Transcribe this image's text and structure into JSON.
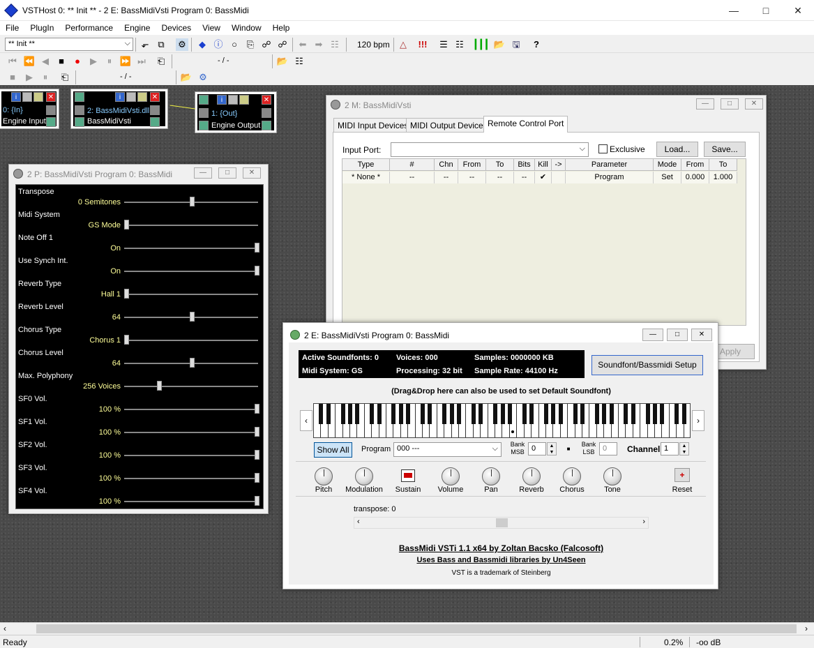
{
  "app": {
    "title": "VSTHost 0: ** Init ** - 2 E: BassMidiVsti Program 0: BassMidi"
  },
  "menu": [
    "File",
    "PlugIn",
    "Performance",
    "Engine",
    "Devices",
    "View",
    "Window",
    "Help"
  ],
  "toolbar": {
    "performance": "** Init **",
    "bpm": "120 bpm",
    "position1": "- / -",
    "position2": "- / -"
  },
  "engine": {
    "input": {
      "line1": "0: {In}",
      "line2": "Engine Input"
    },
    "plugin": {
      "line1": "2: BassMidiVsti.dll",
      "line2": "BassMidiVsti"
    },
    "output": {
      "line1": "1: {Out}",
      "line2": "Engine Output"
    }
  },
  "param_window": {
    "title": "2 P: BassMidiVsti Program 0: BassMidi",
    "params": [
      {
        "label": "Transpose",
        "value": "0 Semitones",
        "level": 0.5
      },
      {
        "label": "Midi System",
        "value": "GS Mode",
        "level": 0.0
      },
      {
        "label": "Note Off 1",
        "value": "On",
        "level": 1.0
      },
      {
        "label": "Use Synch Int.",
        "value": "On",
        "level": 1.0
      },
      {
        "label": "Reverb Type",
        "value": "Hall 1",
        "level": 0.0
      },
      {
        "label": "Reverb Level",
        "value": "64",
        "level": 0.5
      },
      {
        "label": "Chorus Type",
        "value": "Chorus 1",
        "level": 0.0
      },
      {
        "label": "Chorus Level",
        "value": "64",
        "level": 0.5
      },
      {
        "label": "Max. Polyphony",
        "value": "256 Voices",
        "level": 0.25
      },
      {
        "label": "SF0 Vol.",
        "value": "100 %",
        "level": 1.0
      },
      {
        "label": "SF1 Vol.",
        "value": "100 %",
        "level": 1.0
      },
      {
        "label": "SF2 Vol.",
        "value": "100 %",
        "level": 1.0
      },
      {
        "label": "SF3 Vol.",
        "value": "100 %",
        "level": 1.0
      },
      {
        "label": "SF4 Vol.",
        "value": "100 %",
        "level": 1.0
      }
    ]
  },
  "midi_window": {
    "title": "2 M: BassMidiVsti",
    "tabs": [
      "MIDI Input Devices",
      "MIDI Output Devices",
      "Remote Control Port"
    ],
    "input_port_label": "Input Port:",
    "exclusive_label": "Exclusive",
    "load_label": "Load...",
    "save_label": "Save...",
    "apply_label": "Apply",
    "columns": [
      "Type",
      "#",
      "Chn",
      "From",
      "To",
      "Bits",
      "Kill",
      "->",
      "Parameter",
      "Mode",
      "From",
      "To"
    ],
    "row": [
      "* None *",
      "--",
      "--",
      "--",
      "--",
      "--",
      "✔",
      "",
      "Program",
      "Set",
      "0.000",
      "1.000"
    ]
  },
  "bassmidi_window": {
    "title": "2 E: BassMidiVsti Program 0: BassMidi",
    "info": {
      "active_soundfonts": "Active Soundfonts: 0",
      "voices": "Voices: 000",
      "samples": "Samples: 0000000 KB",
      "midi_system": "Midi System: GS",
      "processing": "Processing: 32 bit",
      "sample_rate": "Sample Rate: 44100 Hz"
    },
    "setup_button": "Soundfont/Bassmidi Setup",
    "drag_hint": "(Drag&Drop here can also be used to set Default Soundfont)",
    "show_all": "Show All",
    "program_label": "Program",
    "program_value": "000 ---",
    "bank_msb_label": "Bank MSB",
    "bank_msb_value": "0",
    "bank_lsb_label": "Bank LSB",
    "bank_lsb_value": "0",
    "channel_label": "Channel",
    "channel_value": "1",
    "knobs": [
      "Pitch",
      "Modulation",
      "Sustain",
      "Volume",
      "Pan",
      "Reverb",
      "Chorus",
      "Tone",
      "Reset"
    ],
    "transpose_label": "transpose: 0",
    "credit1": "BassMidi VSTi 1.1 x64 by Zoltan Bacsko (Falcosoft)",
    "credit2": "Uses Bass and Bassmidi libraries by Un4Seen",
    "credit3": "VST is a trademark of Steinberg"
  },
  "status": {
    "left": "Ready",
    "cpu": "0.2%",
    "level": "-oo dB"
  }
}
